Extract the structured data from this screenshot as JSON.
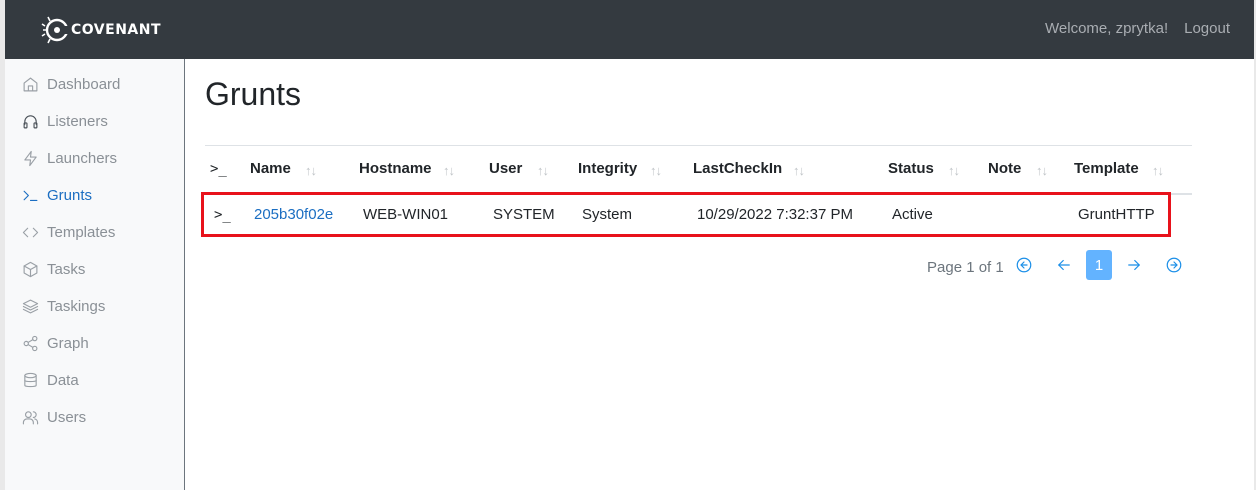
{
  "header": {
    "brand": "COVENANT",
    "welcome": "Welcome, zprytka!",
    "logout": "Logout"
  },
  "sidebar": {
    "items": [
      {
        "label": "Dashboard",
        "icon": "home-icon"
      },
      {
        "label": "Listeners",
        "icon": "headphones-icon"
      },
      {
        "label": "Launchers",
        "icon": "lightning-icon"
      },
      {
        "label": "Grunts",
        "icon": "terminal-icon",
        "active": true
      },
      {
        "label": "Templates",
        "icon": "code-icon"
      },
      {
        "label": "Tasks",
        "icon": "box-icon"
      },
      {
        "label": "Taskings",
        "icon": "layers-icon"
      },
      {
        "label": "Graph",
        "icon": "share-icon"
      },
      {
        "label": "Data",
        "icon": "database-icon"
      },
      {
        "label": "Users",
        "icon": "users-icon"
      }
    ]
  },
  "main": {
    "title": "Grunts",
    "table": {
      "columns": [
        "Name",
        "Hostname",
        "User",
        "Integrity",
        "LastCheckIn",
        "Status",
        "Note",
        "Template"
      ],
      "sort_glyph": "↑↓",
      "rows": [
        {
          "name": "205b30f02e",
          "hostname": "WEB-WIN01",
          "user": "SYSTEM",
          "integrity": "System",
          "lastcheckin": "10/29/2022 7:32:37 PM",
          "status": "Active",
          "note": "",
          "template": "GruntHTTP"
        }
      ]
    },
    "pagination": {
      "summary": "Page 1 of 1",
      "current_page": "1"
    }
  },
  "colors": {
    "topbar": "#343a40",
    "link": "#1b6ec2",
    "highlight": "#e8121b",
    "page_active": "#63b3ff"
  }
}
